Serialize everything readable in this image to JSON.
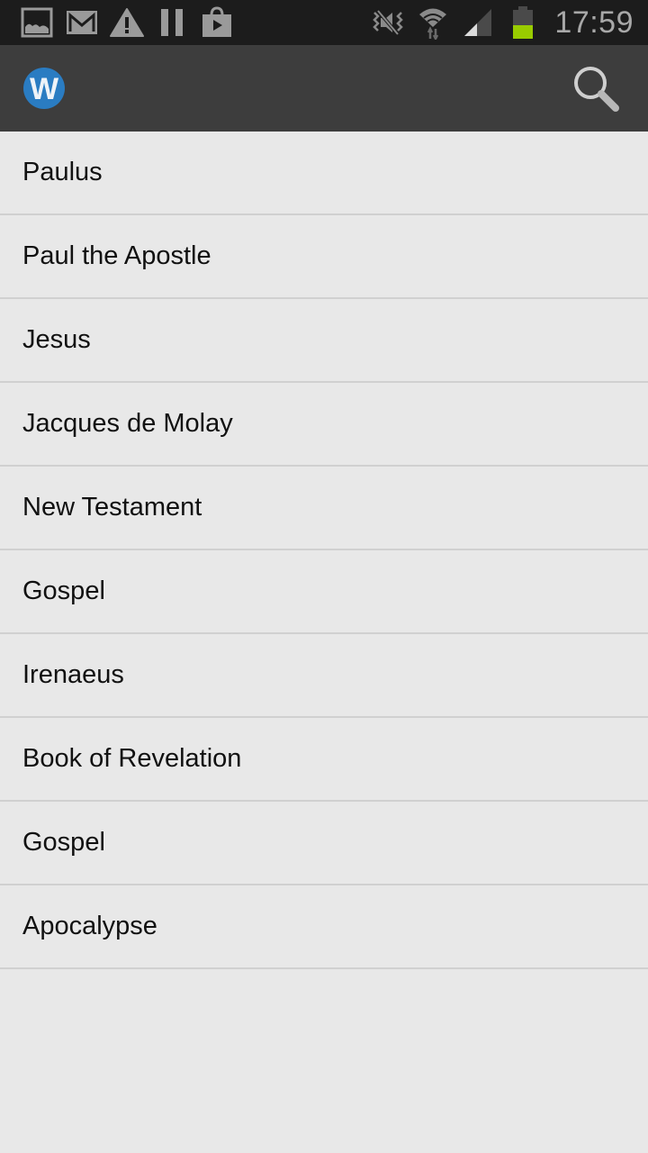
{
  "status_bar": {
    "notification_icons": [
      "gallery-icon",
      "gmail-icon",
      "warning-icon",
      "pause-icon",
      "play-store-icon"
    ],
    "system_icons": [
      "vibrate-mute-icon",
      "wifi-icon",
      "signal-icon",
      "battery-icon"
    ],
    "battery_color": "#99cc00",
    "time": "17:59"
  },
  "action_bar": {
    "logo_letter": "W",
    "logo_color": "#2a7cc2",
    "search_icon": "search-icon"
  },
  "list": {
    "items": [
      {
        "label": "Paulus"
      },
      {
        "label": "Paul the Apostle"
      },
      {
        "label": "Jesus"
      },
      {
        "label": "Jacques de Molay"
      },
      {
        "label": "New Testament"
      },
      {
        "label": "Gospel"
      },
      {
        "label": "Irenaeus"
      },
      {
        "label": "Book of Revelation"
      },
      {
        "label": "Gospel"
      },
      {
        "label": "Apocalypse"
      }
    ]
  }
}
